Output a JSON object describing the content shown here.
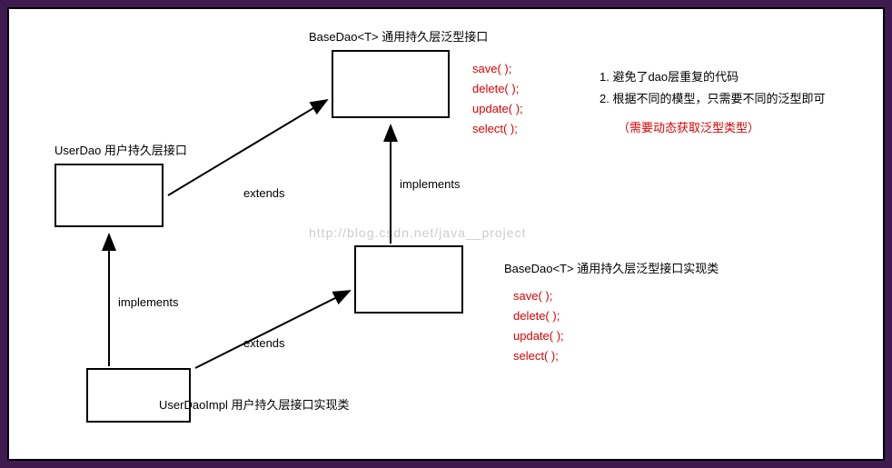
{
  "titles": {
    "baseDao": "BaseDao<T> 通用持久层泛型接口",
    "userDao": "UserDao 用户持久层接口",
    "baseDaoImpl": "BaseDao<T> 通用持久层泛型接口实现类",
    "userDaoImpl": "UserDaoImpl 用户持久层接口实现类"
  },
  "methods": {
    "top": {
      "save": "save( );",
      "delete": "delete( );",
      "update": "update( );",
      "select": "select( );"
    },
    "bottom": {
      "save": "save( );",
      "delete": "delete( );",
      "update": "update( );",
      "select": "select( );"
    }
  },
  "relations": {
    "extends1": "extends",
    "implements1": "implements",
    "implements2": "implements",
    "extends2": "extends"
  },
  "notes": {
    "line1": "1. 避免了dao层重复的代码",
    "line2": "2. 根据不同的模型，只需要不同的泛型即可",
    "line3": "（需要动态获取泛型类型）"
  },
  "watermark": "http://blog.csdn.net/java__project"
}
